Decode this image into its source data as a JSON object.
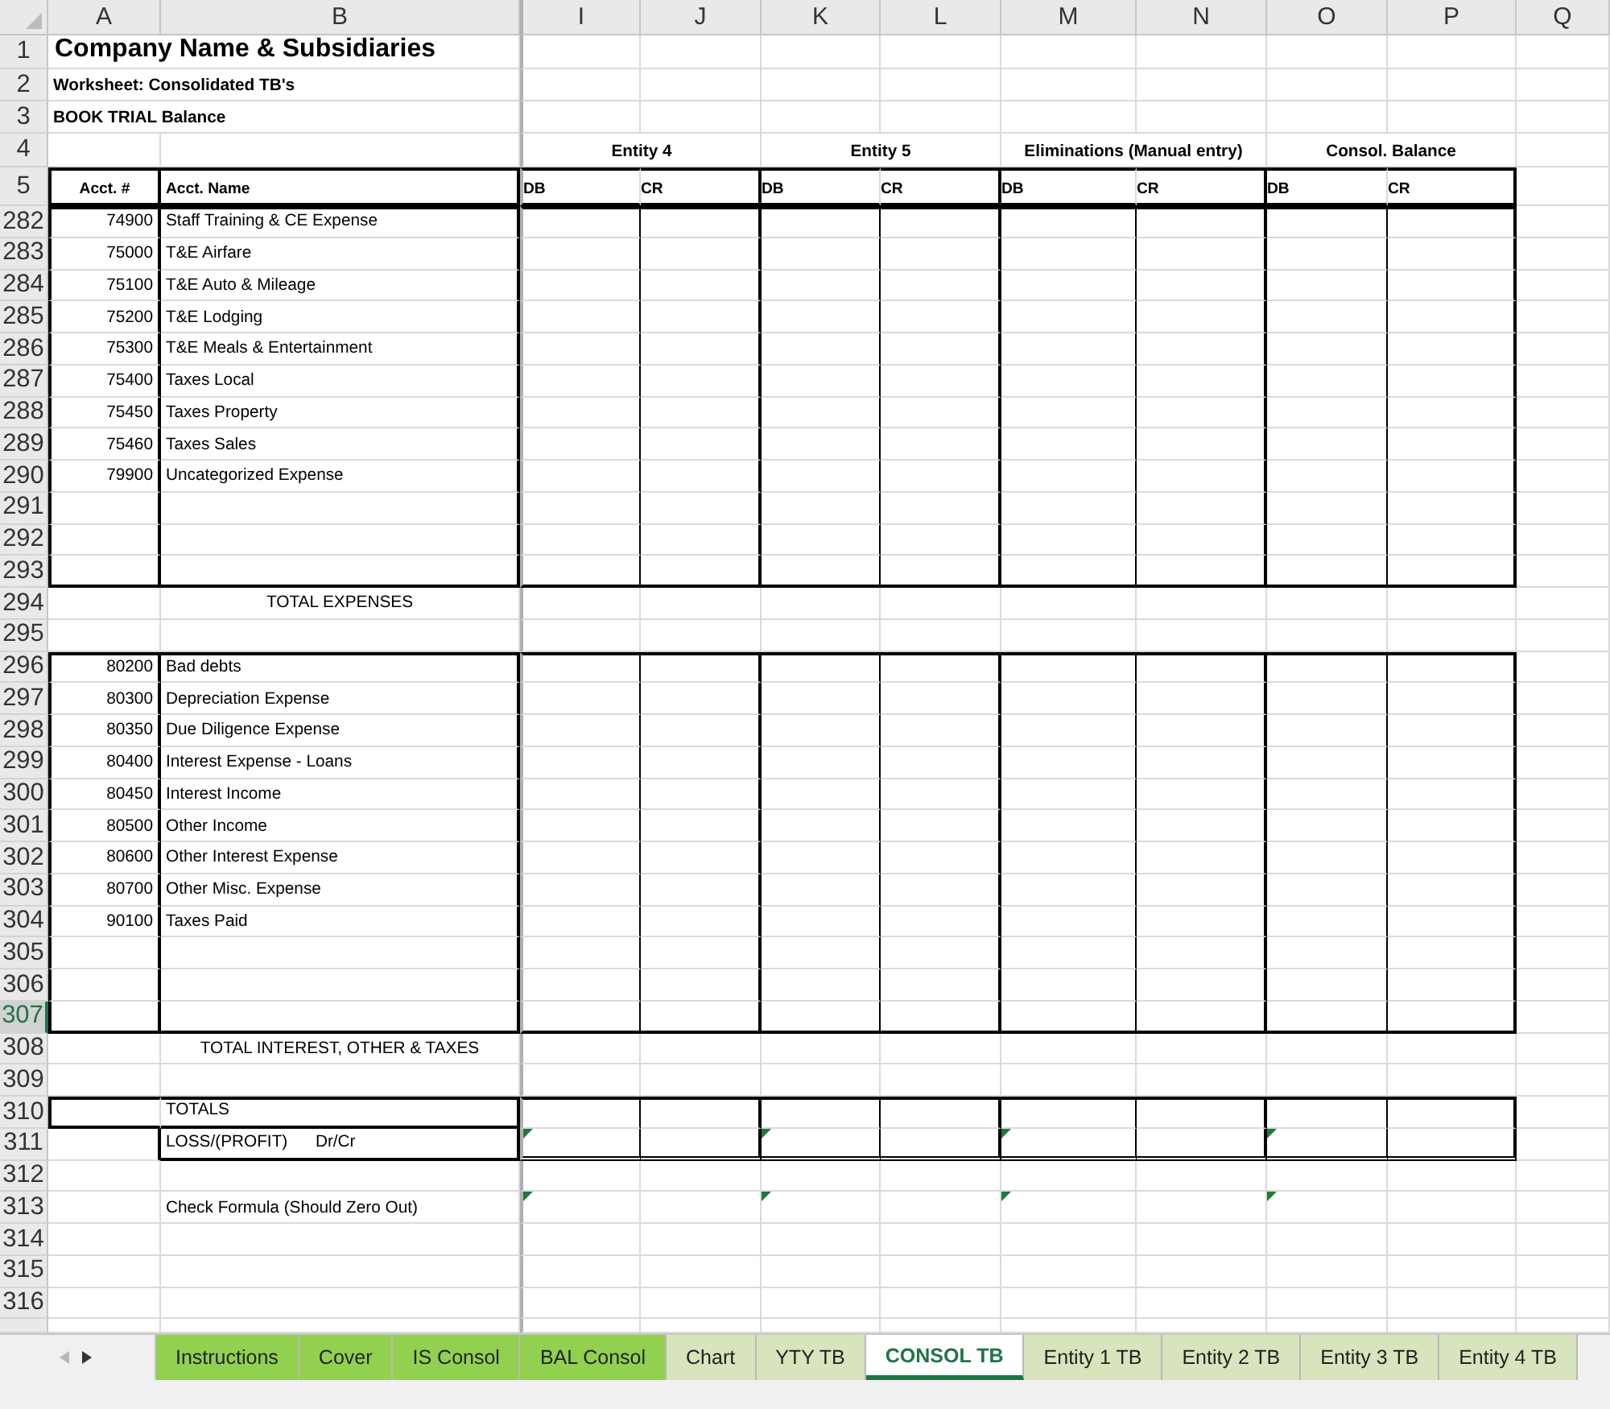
{
  "columns": [
    "A",
    "B",
    "I",
    "J",
    "K",
    "L",
    "M",
    "N",
    "O",
    "P",
    "Q"
  ],
  "rows": [
    {
      "number": "1",
      "kind": "title",
      "selected": false,
      "text": "Company Name & Subsidiaries"
    },
    {
      "number": "2",
      "kind": "note",
      "selected": false,
      "text": "Worksheet: Consolidated TB's"
    },
    {
      "number": "3",
      "kind": "note",
      "selected": false,
      "text": "BOOK TRIAL Balance"
    },
    {
      "number": "4",
      "kind": "groups",
      "selected": false,
      "groups": [
        "Entity 4",
        "Entity 5",
        "Eliminations (Manual entry)",
        "Consol. Balance"
      ]
    },
    {
      "number": "5",
      "kind": "headings",
      "selected": false,
      "acct_no": "Acct. #",
      "acct_name": "Acct. Name",
      "amounts": [
        "DB",
        "CR",
        "DB",
        "CR",
        "DB",
        "CR",
        "DB",
        "CR"
      ]
    },
    {
      "number": "282",
      "kind": "account",
      "selected": false,
      "acct_no": "74900",
      "acct_name": "Staff Training & CE Expense"
    },
    {
      "number": "283",
      "kind": "account",
      "selected": false,
      "acct_no": "75000",
      "acct_name": "T&E Airfare"
    },
    {
      "number": "284",
      "kind": "account",
      "selected": false,
      "acct_no": "75100",
      "acct_name": "T&E Auto & Mileage"
    },
    {
      "number": "285",
      "kind": "account",
      "selected": false,
      "acct_no": "75200",
      "acct_name": "T&E Lodging"
    },
    {
      "number": "286",
      "kind": "account",
      "selected": false,
      "acct_no": "75300",
      "acct_name": "T&E Meals & Entertainment"
    },
    {
      "number": "287",
      "kind": "account",
      "selected": false,
      "acct_no": "75400",
      "acct_name": "Taxes Local"
    },
    {
      "number": "288",
      "kind": "account",
      "selected": false,
      "acct_no": "75450",
      "acct_name": "Taxes Property"
    },
    {
      "number": "289",
      "kind": "account",
      "selected": false,
      "acct_no": "75460",
      "acct_name": "Taxes Sales"
    },
    {
      "number": "290",
      "kind": "account",
      "selected": false,
      "acct_no": "79900",
      "acct_name": "Uncategorized Expense"
    },
    {
      "number": "291",
      "kind": "account",
      "selected": false
    },
    {
      "number": "292",
      "kind": "account",
      "selected": false
    },
    {
      "number": "293",
      "kind": "account",
      "selected": false
    },
    {
      "number": "294",
      "kind": "subtotal",
      "selected": false,
      "text": "TOTAL EXPENSES"
    },
    {
      "number": "295",
      "kind": "blank",
      "selected": false
    },
    {
      "number": "296",
      "kind": "account",
      "selected": false,
      "acct_no": "80200",
      "acct_name": "Bad debts"
    },
    {
      "number": "297",
      "kind": "account",
      "selected": false,
      "acct_no": "80300",
      "acct_name": "Depreciation Expense"
    },
    {
      "number": "298",
      "kind": "account",
      "selected": false,
      "acct_no": "80350",
      "acct_name": "Due Diligence Expense"
    },
    {
      "number": "299",
      "kind": "account",
      "selected": false,
      "acct_no": "80400",
      "acct_name": "Interest Expense - Loans"
    },
    {
      "number": "300",
      "kind": "account",
      "selected": false,
      "acct_no": "80450",
      "acct_name": "Interest Income"
    },
    {
      "number": "301",
      "kind": "account",
      "selected": false,
      "acct_no": "80500",
      "acct_name": "Other Income"
    },
    {
      "number": "302",
      "kind": "account",
      "selected": false,
      "acct_no": "80600",
      "acct_name": "Other Interest Expense"
    },
    {
      "number": "303",
      "kind": "account",
      "selected": false,
      "acct_no": "80700",
      "acct_name": "Other Misc. Expense"
    },
    {
      "number": "304",
      "kind": "account",
      "selected": false,
      "acct_no": "90100",
      "acct_name": "Taxes Paid"
    },
    {
      "number": "305",
      "kind": "account",
      "selected": false
    },
    {
      "number": "306",
      "kind": "account",
      "selected": false
    },
    {
      "number": "307",
      "kind": "account",
      "selected": true
    },
    {
      "number": "308",
      "kind": "subtotal",
      "selected": false,
      "text": "TOTAL INTEREST, OTHER & TAXES"
    },
    {
      "number": "309",
      "kind": "blank",
      "selected": false
    },
    {
      "number": "310",
      "kind": "totals",
      "selected": false,
      "text": "TOTALS"
    },
    {
      "number": "311",
      "kind": "result",
      "selected": false,
      "text": "LOSS/(PROFIT)      Dr/Cr",
      "flags": [
        true,
        false,
        true,
        false,
        true,
        false,
        true,
        false
      ]
    },
    {
      "number": "312",
      "kind": "blank",
      "selected": false
    },
    {
      "number": "313",
      "kind": "check",
      "selected": false,
      "text": "Check Formula (Should Zero Out)",
      "flags": [
        true,
        false,
        true,
        false,
        true,
        false,
        true,
        false
      ]
    },
    {
      "number": "314",
      "kind": "blank",
      "selected": false
    },
    {
      "number": "315",
      "kind": "blank",
      "selected": false
    },
    {
      "number": "316",
      "kind": "blank",
      "selected": false
    }
  ],
  "tab_nav": [
    {
      "kind": "left",
      "disabled": true
    },
    {
      "kind": "right",
      "disabled": false
    }
  ],
  "sheet_tabs": [
    {
      "label": "Instructions",
      "color": "#92d050",
      "selected": false
    },
    {
      "label": "Cover",
      "color": "#92d050",
      "selected": false
    },
    {
      "label": "IS Consol",
      "color": "#92d050",
      "selected": false
    },
    {
      "label": "BAL Consol",
      "color": "#92d050",
      "selected": false
    },
    {
      "label": "Chart",
      "color": "#d8e4bc",
      "selected": false
    },
    {
      "label": "YTY TB",
      "color": "#d8e4bc",
      "selected": false
    },
    {
      "label": "CONSOL TB",
      "color": "#217346",
      "selected": true
    },
    {
      "label": "Entity 1 TB",
      "color": "#d8e4bc",
      "selected": false
    },
    {
      "label": "Entity 2 TB",
      "color": "#d8e4bc",
      "selected": false
    },
    {
      "label": "Entity 3 TB",
      "color": "#d8e4bc",
      "selected": false
    },
    {
      "label": "Entity 4 TB",
      "color": "#d8e4bc",
      "selected": false
    }
  ]
}
